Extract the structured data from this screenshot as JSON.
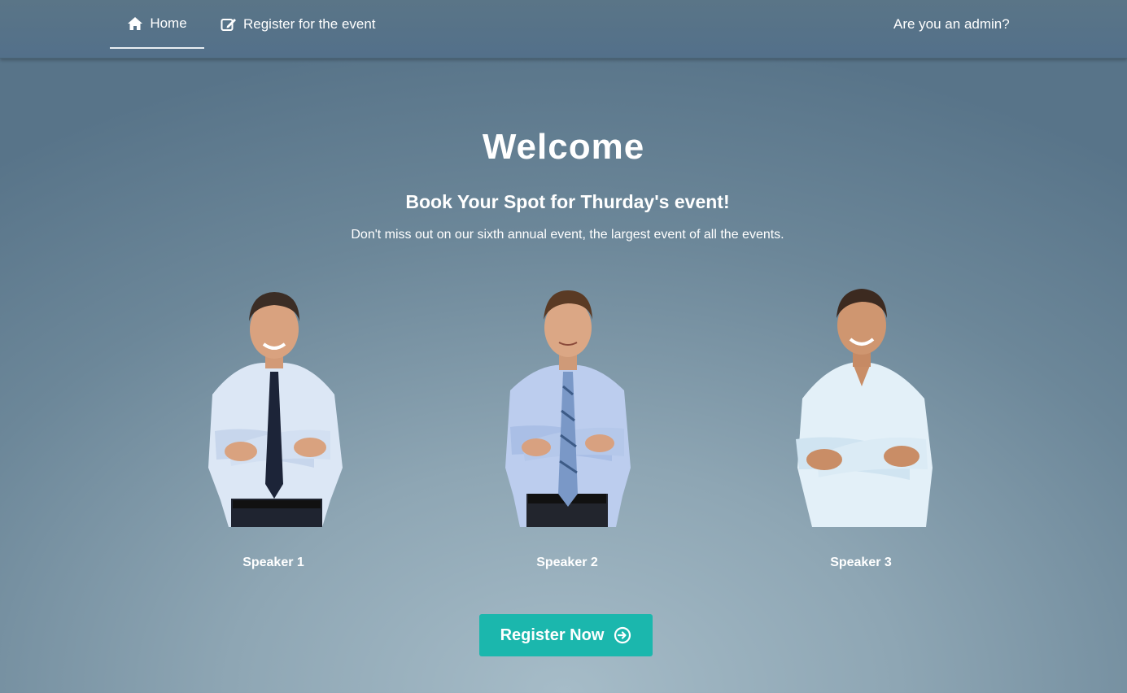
{
  "nav": {
    "home_label": "Home",
    "home_icon": "home-icon",
    "register_label": "Register for the event",
    "register_icon": "edit-icon",
    "admin_label": "Are you an admin?"
  },
  "hero": {
    "title": "Welcome",
    "subtitle": "Book Your Spot for Thurday's event!",
    "description": "Don't miss out on our sixth annual event, the largest event of all the events."
  },
  "speakers": [
    {
      "name": "Speaker 1"
    },
    {
      "name": "Speaker 2"
    },
    {
      "name": "Speaker 3"
    }
  ],
  "cta": {
    "label": "Register Now",
    "icon": "arrow-circle-right-icon",
    "color": "#1bb7ad"
  }
}
